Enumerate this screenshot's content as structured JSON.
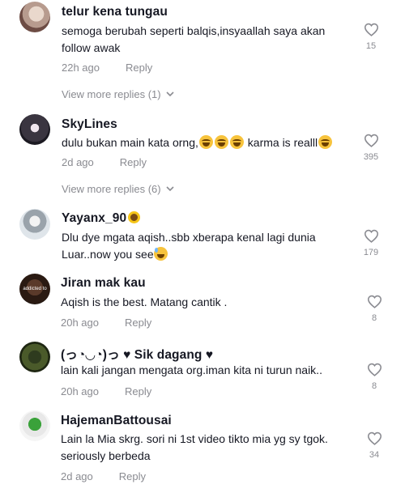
{
  "comments": [
    {
      "username": "telur kena tungau",
      "text": "semoga berubah seperti balqis,insyaallah saya akan follow awak",
      "time": "22h ago",
      "reply": "Reply",
      "likes": "15",
      "view_more": "View more replies (1)"
    },
    {
      "username": "SkyLines",
      "text_parts": [
        "dulu bukan main kata orng,",
        " karma is realll"
      ],
      "time": "2d ago",
      "reply": "Reply",
      "likes": "395",
      "view_more": "View more replies (6)"
    },
    {
      "username": "Yayanx_90",
      "text_parts": [
        "Dlu dye mgata aqish..sbb xberapa kenal lagi dunia Luar..now you see"
      ],
      "time": "",
      "reply": "",
      "likes": "179"
    },
    {
      "username": "Jiran mak kau",
      "text": "Aqish is the best. Matang cantik .",
      "time": "20h ago",
      "reply": "Reply",
      "likes": "8",
      "avatar_text": "addicted to"
    },
    {
      "username": "(っ◔◡◔)っ ♥ Sik dagang ♥",
      "text": "lain kali jangan mengata org.iman kita ni turun naik..",
      "time": "20h ago",
      "reply": "Reply",
      "likes": "8"
    },
    {
      "username": "HajemanBattousai",
      "text": "Lain la Mia skrg. sori ni 1st video tikto mia yg sy tgok. seriously berbeda",
      "time": "2d ago",
      "reply": "Reply",
      "likes": "34"
    }
  ],
  "colors": {
    "text": "#161823",
    "muted": "#8a8b91",
    "background": "#ffffff"
  }
}
